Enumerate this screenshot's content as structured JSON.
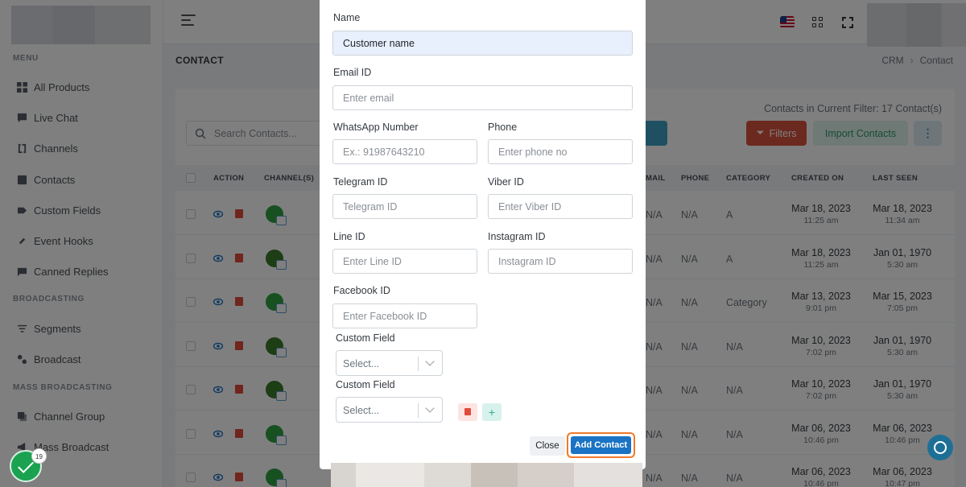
{
  "sidebar": {
    "sections": [
      "MENU",
      "BROADCASTING",
      "MASS BROADCASTING"
    ],
    "items": [
      {
        "label": "All Products",
        "icon": "grid-icon"
      },
      {
        "label": "Live Chat",
        "icon": "chat-icon"
      },
      {
        "label": "Channels",
        "icon": "channels-icon"
      },
      {
        "label": "Contacts",
        "icon": "contacts-icon"
      },
      {
        "label": "Custom Fields",
        "icon": "tag-icon"
      },
      {
        "label": "Event Hooks",
        "icon": "link-icon"
      },
      {
        "label": "Canned Replies",
        "icon": "message-icon"
      },
      {
        "label": "Segments",
        "icon": "filter-icon"
      },
      {
        "label": "Broadcast",
        "icon": "broadcast-icon"
      },
      {
        "label": "Channel Group",
        "icon": "group-icon"
      },
      {
        "label": "Mass Broadcast",
        "icon": "megaphone-icon"
      }
    ]
  },
  "header": {
    "page_title": "CONTACT",
    "breadcrumb": [
      "CRM",
      "Contact"
    ]
  },
  "toolbar": {
    "filter_info": "Contacts in Current Filter: 17 Contact(s)",
    "search_placeholder": "Search Contacts...",
    "filters_label": "Filters",
    "import_label": "Import Contacts",
    "more_label": "⋮"
  },
  "table": {
    "columns": [
      "ACTION",
      "CHANNEL(S)",
      "MAIL",
      "PHONE",
      "CATEGORY",
      "CREATED ON",
      "LAST SEEN"
    ],
    "rows": [
      {
        "mail": "N/A",
        "phone": "N/A",
        "category": "A",
        "created": "Mar 18, 2023",
        "created_time": "11:25 am",
        "last_seen": "Mar 18, 2023",
        "last_seen_time": "11:34 am"
      },
      {
        "mail": "N/A",
        "phone": "N/A",
        "category": "A",
        "created": "Mar 18, 2023",
        "created_time": "11:25 am",
        "last_seen": "Jan 01, 1970",
        "last_seen_time": "5:30 am"
      },
      {
        "mail": "N/A",
        "phone": "N/A",
        "category": "Category",
        "created": "Mar 13, 2023",
        "created_time": "9:01 pm",
        "last_seen": "Mar 15, 2023",
        "last_seen_time": "7:05 pm"
      },
      {
        "mail": "N/A",
        "phone": "N/A",
        "category": "N/A",
        "created": "Mar 10, 2023",
        "created_time": "7:02 pm",
        "last_seen": "Jan 01, 1970",
        "last_seen_time": "5:30 am"
      },
      {
        "mail": "N/A",
        "phone": "N/A",
        "category": "N/A",
        "created": "Mar 10, 2023",
        "created_time": "7:02 pm",
        "last_seen": "Jan 01, 1970",
        "last_seen_time": "5:30 am"
      },
      {
        "mail": "N/A",
        "phone": "N/A",
        "category": "N/A",
        "created": "Mar 06, 2023",
        "created_time": "10:46 pm",
        "last_seen": "Mar 06, 2023",
        "last_seen_time": "10:46 pm"
      },
      {
        "mail": "N/A",
        "phone": "N/A",
        "category": "N/A",
        "created": "Mar 06, 2023",
        "created_time": "10:46 pm",
        "last_seen": "Mar 06, 2023",
        "last_seen_time": "10:47 pm"
      }
    ]
  },
  "modal": {
    "name_label": "Name",
    "name_value": "Customer name",
    "email_label": "Email ID",
    "email_placeholder": "Enter email",
    "whatsapp_label": "WhatsApp Number",
    "whatsapp_placeholder": "Ex.: 91987643210",
    "phone_label": "Phone",
    "phone_placeholder": "Enter phone no",
    "telegram_label": "Telegram ID",
    "telegram_placeholder": "Telegram ID",
    "viber_label": "Viber ID",
    "viber_placeholder": "Enter Viber ID",
    "line_label": "Line ID",
    "line_placeholder": "Enter Line ID",
    "instagram_label": "Instagram ID",
    "instagram_placeholder": "Instagram ID",
    "facebook_label": "Facebook ID",
    "facebook_placeholder": "Enter Facebook ID",
    "custom_field_label": "Custom Field",
    "custom_field_select": "Select...",
    "add_row_label": "+",
    "close_label": "Close",
    "submit_label": "Add Contact"
  },
  "floating": {
    "badge_count": "19"
  },
  "colors": {
    "primary": "#1a73c4",
    "danger": "#d9533f",
    "success": "#2e9b6f",
    "highlight_ring": "#f07a2a"
  }
}
